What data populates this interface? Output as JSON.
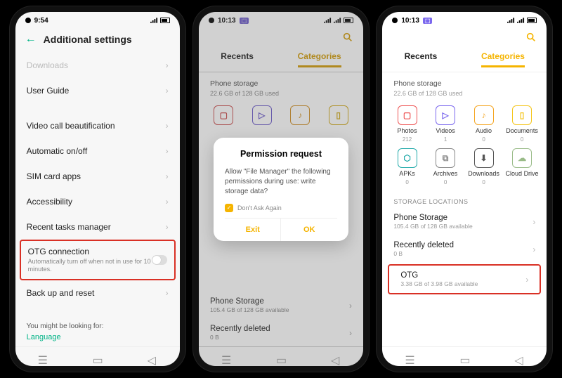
{
  "phone1": {
    "time": "9:54",
    "title": "Additional settings",
    "items": {
      "downloads": "Downloads",
      "user_guide": "User Guide",
      "video_call": "Video call beautification",
      "auto_onoff": "Automatic on/off",
      "sim_apps": "SIM card apps",
      "accessibility": "Accessibility",
      "recent_tasks": "Recent tasks manager",
      "otg": {
        "title": "OTG connection",
        "sub": "Automatically turn off when not in use for 10 minutes."
      },
      "backup": "Back up and reset"
    },
    "footer_label": "You might be looking for:",
    "footer_link": "Language"
  },
  "phone2": {
    "time": "10:13",
    "tabs": {
      "recents": "Recents",
      "categories": "Categories"
    },
    "storage": {
      "title": "Phone storage",
      "sub": "22.6 GB of 128 GB used"
    },
    "dialog": {
      "title": "Permission request",
      "msg": "Allow \"File Manager\" the following permissions during use: write storage data?",
      "check": "Don't Ask Again",
      "exit": "Exit",
      "ok": "OK"
    },
    "locations": {
      "phone": {
        "title": "Phone Storage",
        "sub": "105.4 GB of 128 GB available"
      },
      "deleted": {
        "title": "Recently deleted",
        "sub": "0 B"
      }
    }
  },
  "phone3": {
    "time": "10:13",
    "tabs": {
      "recents": "Recents",
      "categories": "Categories"
    },
    "storage": {
      "title": "Phone storage",
      "sub": "22.6 GB of 128 GB used"
    },
    "cats": [
      {
        "name": "Photos",
        "count": "212",
        "color": "#e55"
      },
      {
        "name": "Videos",
        "count": "1",
        "color": "#7b68ee"
      },
      {
        "name": "Audio",
        "count": "0",
        "color": "#f5a623"
      },
      {
        "name": "Documents",
        "count": "0",
        "color": "#f5c518"
      },
      {
        "name": "APKs",
        "count": "0",
        "color": "#2aa"
      },
      {
        "name": "Archives",
        "count": "0",
        "color": "#888"
      },
      {
        "name": "Downloads",
        "count": "0",
        "color": "#555"
      },
      {
        "name": "Cloud Drive",
        "count": "",
        "color": "#9b8"
      }
    ],
    "loc_header": "STORAGE LOCATIONS",
    "locations": {
      "phone": {
        "title": "Phone Storage",
        "sub": "105.4 GB of 128 GB available"
      },
      "deleted": {
        "title": "Recently deleted",
        "sub": "0 B"
      },
      "otg": {
        "title": "OTG",
        "sub": "3.38 GB of 3.98 GB available"
      }
    }
  }
}
